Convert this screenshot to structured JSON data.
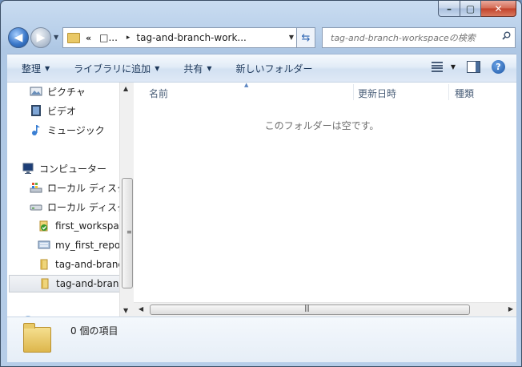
{
  "window": {
    "caption_buttons": {
      "minimize": "–",
      "maximize": "▢",
      "close": "✕"
    }
  },
  "nav": {
    "back_icon": "back-arrow-icon",
    "forward_icon": "forward-arrow-icon"
  },
  "address": {
    "chevron": "«",
    "crumb_truncated": "□...",
    "arrow": "▸",
    "current": "tag-and-branch-work..."
  },
  "search": {
    "placeholder": "tag-and-branch-workspaceの検索"
  },
  "toolbar": {
    "organize": "整理",
    "add_to_library": "ライブラリに追加",
    "share": "共有",
    "new_folder": "新しいフォルダー"
  },
  "sidebar": {
    "items": [
      {
        "label": "ピクチャ",
        "icon": "pictures-icon"
      },
      {
        "label": "ビデオ",
        "icon": "video-icon"
      },
      {
        "label": "ミュージック",
        "icon": "music-icon"
      },
      {
        "label": "コンピューター",
        "icon": "computer-icon"
      },
      {
        "label": "ローカル ディスク",
        "icon": "windows-drive-icon"
      },
      {
        "label": "ローカル ディスク",
        "icon": "drive-icon"
      },
      {
        "label": "first_workspace",
        "icon": "folder-check-icon"
      },
      {
        "label": "my_first_repository",
        "icon": "network-folder-icon"
      },
      {
        "label": "tag-and-branch-workspace",
        "icon": "folder-icon"
      },
      {
        "label": "tag-and-branch-workspace",
        "icon": "folder-icon",
        "selected": true
      }
    ]
  },
  "columns": {
    "name": "名前",
    "date_modified": "更新日時",
    "type": "種類"
  },
  "list": {
    "empty_message": "このフォルダーは空です。"
  },
  "details": {
    "item_count": "0 個の項目"
  },
  "colors": {
    "window_frame": "#b9d0ea",
    "toolbar_text": "#1e395b",
    "folder": "#efd57a"
  }
}
